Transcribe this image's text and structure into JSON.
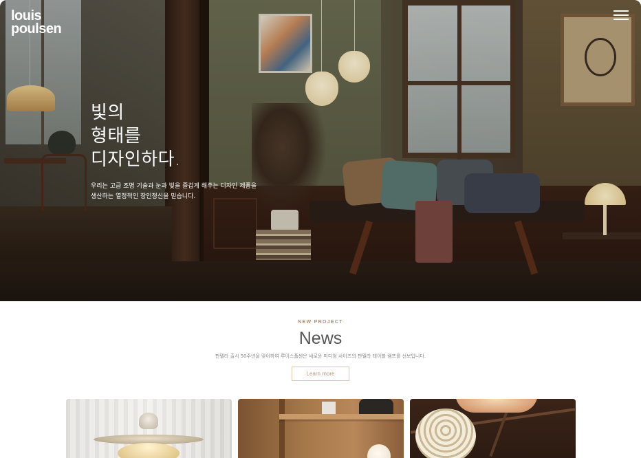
{
  "brand": {
    "logo_line1": "louis",
    "logo_line2": "poulsen"
  },
  "header": {
    "menu_icon": "hamburger-menu-icon"
  },
  "hero": {
    "title_lines": [
      "빛의",
      "형태를",
      "디자인하다."
    ],
    "description_lines": [
      "우리는 고급 조명 기술과 눈과 빛을 즐겁게 해주는 디자인 제품을",
      "생산하는 열정적인 장인정신을 믿습니다."
    ]
  },
  "news": {
    "eyebrow": "NEW PROJECT",
    "title": "News",
    "description": "판텔라 출시 50주년을 맞이하여 루이스폴센은 새로운 미디엄 사이즈의 판텔라 테이블 램프를 선보입니다.",
    "button_label": "Learn more"
  },
  "colors": {
    "accent": "#b08f66",
    "button_border": "#d9c6ad",
    "heading": "#555555"
  }
}
